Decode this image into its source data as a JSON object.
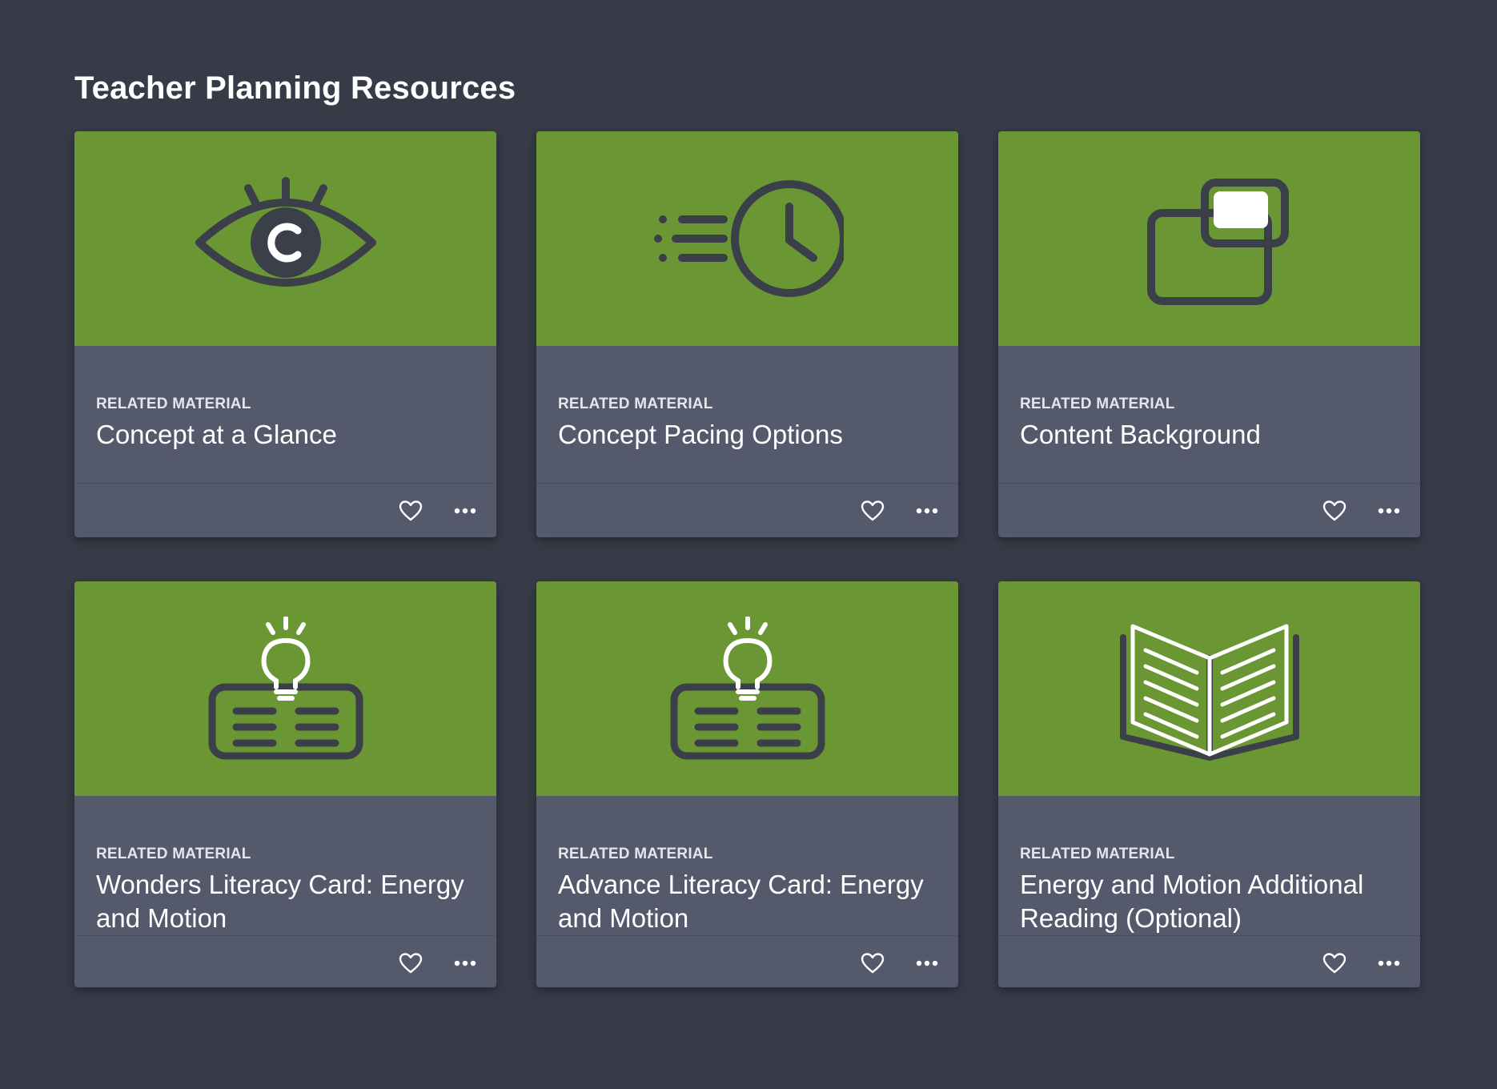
{
  "page": {
    "title": "Teacher Planning Resources"
  },
  "colors": {
    "background": "#373b47",
    "card_body": "#545a6c",
    "card_image": "#6a9733",
    "icon_dark": "#3b3f4a",
    "icon_light": "#ffffff"
  },
  "cards": [
    {
      "kicker": "RELATED MATERIAL",
      "title": "Concept at a Glance",
      "icon": "eye-icon",
      "favorite_icon": "heart-icon",
      "more_icon": "ellipsis-icon"
    },
    {
      "kicker": "RELATED MATERIAL",
      "title": "Concept Pacing Options",
      "icon": "clock-icon",
      "favorite_icon": "heart-icon",
      "more_icon": "ellipsis-icon"
    },
    {
      "kicker": "RELATED MATERIAL",
      "title": "Content Background",
      "icon": "windows-icon",
      "favorite_icon": "heart-icon",
      "more_icon": "ellipsis-icon"
    },
    {
      "kicker": "RELATED MATERIAL",
      "title": "Wonders Literacy Card: Energy and Motion",
      "icon": "lightbulb-card-icon",
      "favorite_icon": "heart-icon",
      "more_icon": "ellipsis-icon"
    },
    {
      "kicker": "RELATED MATERIAL",
      "title": "Advance Literacy Card: Energy and Motion",
      "icon": "lightbulb-card-icon",
      "favorite_icon": "heart-icon",
      "more_icon": "ellipsis-icon"
    },
    {
      "kicker": "RELATED MATERIAL",
      "title": "Energy and Motion Additional Reading (Optional)",
      "icon": "open-book-icon",
      "favorite_icon": "heart-icon",
      "more_icon": "ellipsis-icon"
    }
  ]
}
